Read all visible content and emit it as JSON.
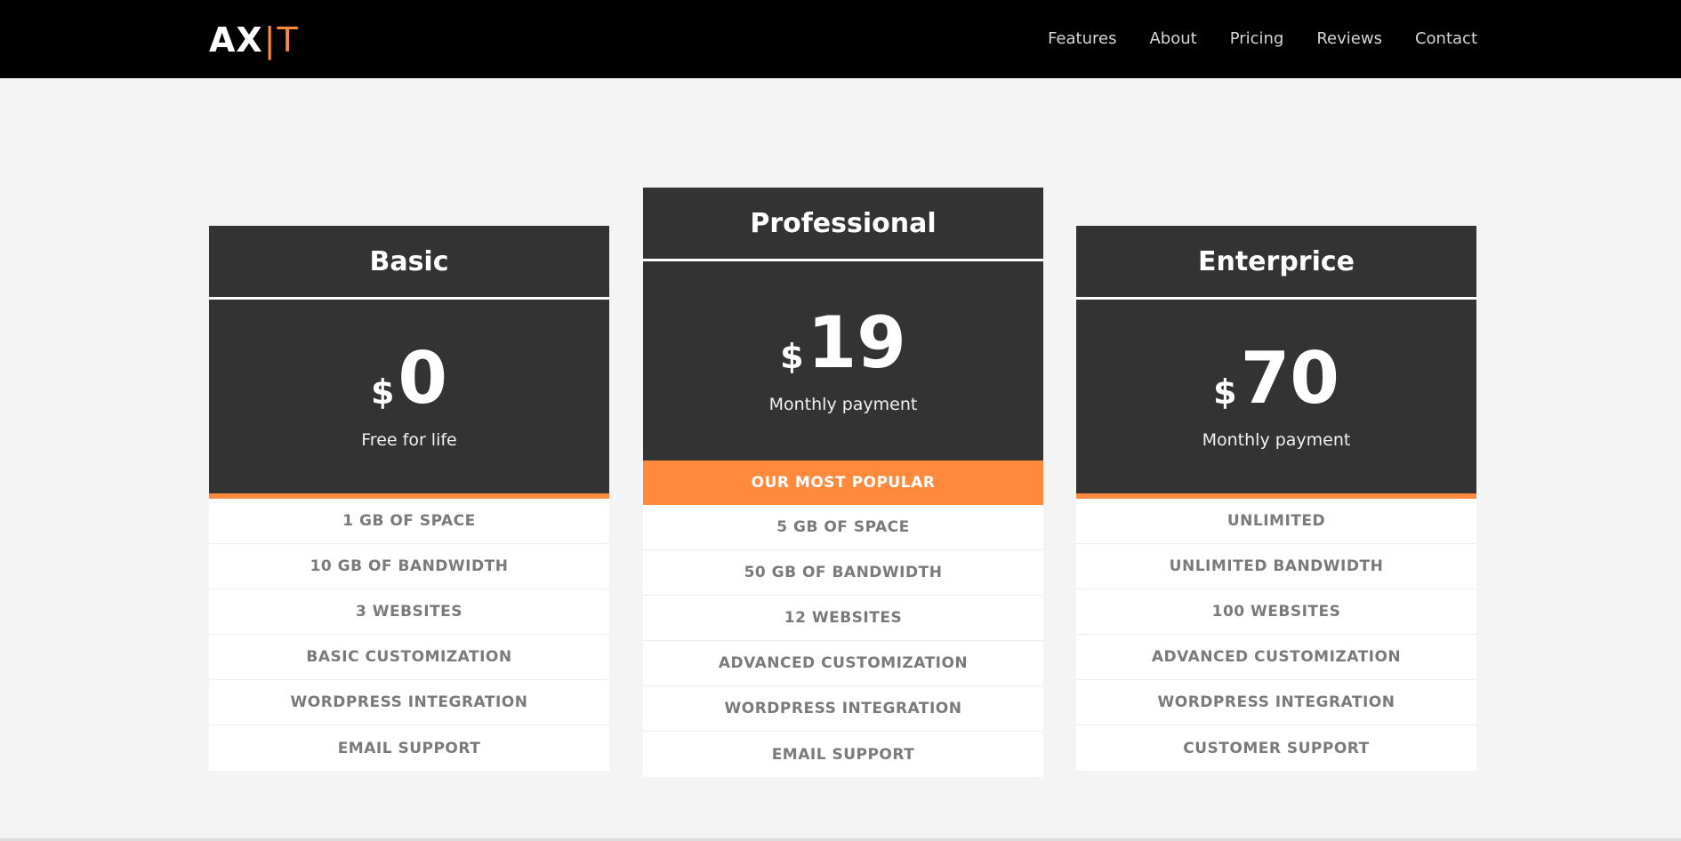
{
  "brand": {
    "main": "AX",
    "separator": "|",
    "accent": "T"
  },
  "nav": {
    "items": [
      "Features",
      "About",
      "Pricing",
      "Reviews",
      "Contact"
    ]
  },
  "colors": {
    "accent": "#ff8a3d",
    "dark": "#333333",
    "navbar": "#000000"
  },
  "plans": [
    {
      "name": "Basic",
      "currency": "$",
      "amount": "0",
      "subtitle": "Free for life",
      "badge": "",
      "features": [
        "1 GB OF SPACE",
        "10 GB OF BANDWIDTH",
        "3 WEBSITES",
        "BASIC CUSTOMIZATION",
        "WORDPRESS INTEGRATION",
        "EMAIL SUPPORT"
      ]
    },
    {
      "name": "Professional",
      "currency": "$",
      "amount": "19",
      "subtitle": "Monthly payment",
      "badge": "OUR MOST POPULAR",
      "features": [
        "5 GB OF SPACE",
        "50 GB OF BANDWIDTH",
        "12 WEBSITES",
        "ADVANCED CUSTOMIZATION",
        "WORDPRESS INTEGRATION",
        "EMAIL SUPPORT"
      ]
    },
    {
      "name": "Enterprice",
      "currency": "$",
      "amount": "70",
      "subtitle": "Monthly payment",
      "badge": "",
      "features": [
        "UNLIMITED",
        "UNLIMITED BANDWIDTH",
        "100 WEBSITES",
        "ADVANCED CUSTOMIZATION",
        "WORDPRESS INTEGRATION",
        "CUSTOMER SUPPORT"
      ]
    }
  ]
}
